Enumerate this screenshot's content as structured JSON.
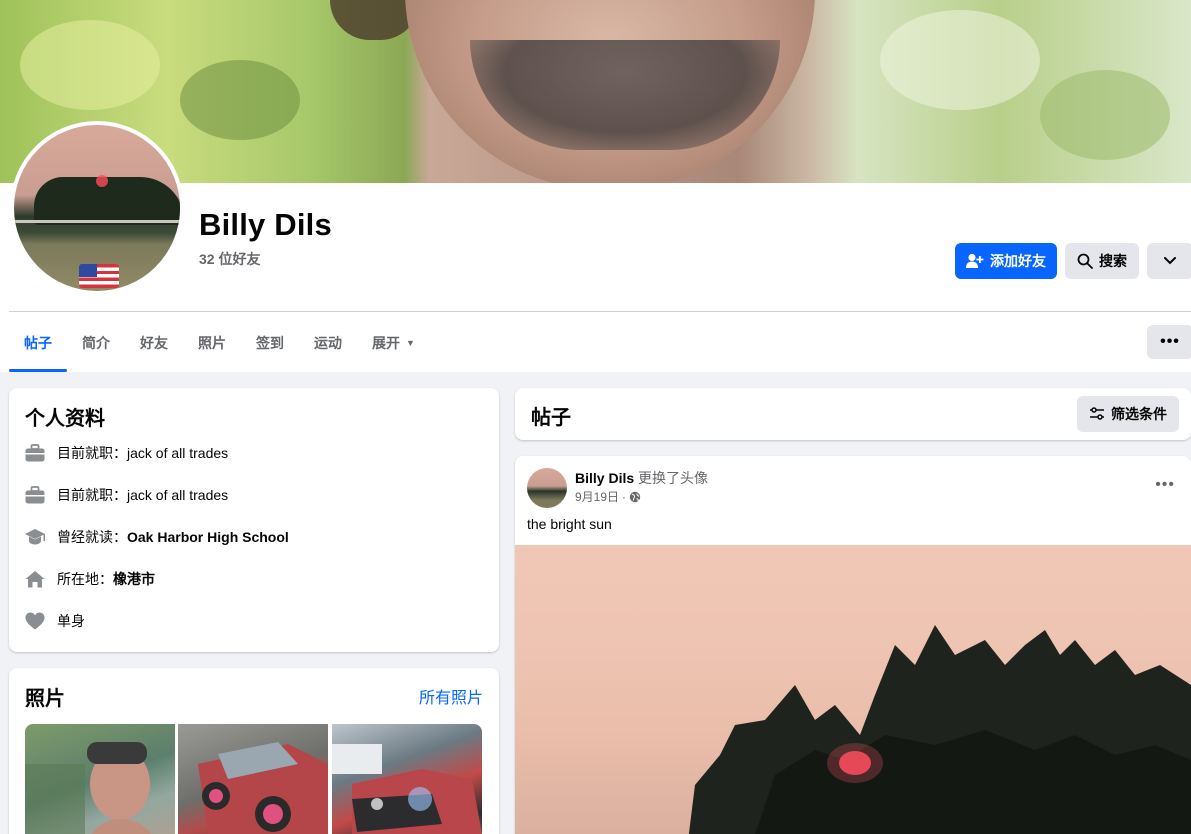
{
  "profile": {
    "name": "Billy Dils",
    "friends_count": "32 位好友"
  },
  "actions": {
    "add_friend": "添加好友",
    "search": "搜索"
  },
  "tabs": [
    {
      "label": "帖子",
      "active": true
    },
    {
      "label": "简介"
    },
    {
      "label": "好友"
    },
    {
      "label": "照片"
    },
    {
      "label": "签到"
    },
    {
      "label": "运动"
    },
    {
      "label": "展开"
    }
  ],
  "intro": {
    "title": "个人资料",
    "items": [
      {
        "icon": "briefcase-icon",
        "prefix": "目前就职：",
        "value": "jack of all trades",
        "bold": false
      },
      {
        "icon": "briefcase-icon",
        "prefix": "目前就职：",
        "value": "jack of all trades",
        "bold": false
      },
      {
        "icon": "graduation-cap-icon",
        "prefix": "曾经就读：",
        "value": "Oak Harbor High School",
        "bold": true
      },
      {
        "icon": "home-icon",
        "prefix": "所在地：",
        "value": "橡港市",
        "bold": true
      },
      {
        "icon": "heart-icon",
        "prefix": "",
        "value": "单身",
        "bold": false
      }
    ]
  },
  "photos": {
    "title": "照片",
    "all_photos": "所有照片"
  },
  "posts": {
    "title": "帖子",
    "filter": "筛选条件"
  },
  "post": {
    "author": "Billy Dils",
    "action": "更换了头像",
    "date": "9月19日",
    "separator": "·",
    "text": "the bright sun"
  },
  "colors": {
    "accent": "#0866ff",
    "page_bg": "#f0f2f5",
    "secondary_text": "#65676b",
    "button_gray": "#e4e6eb"
  }
}
